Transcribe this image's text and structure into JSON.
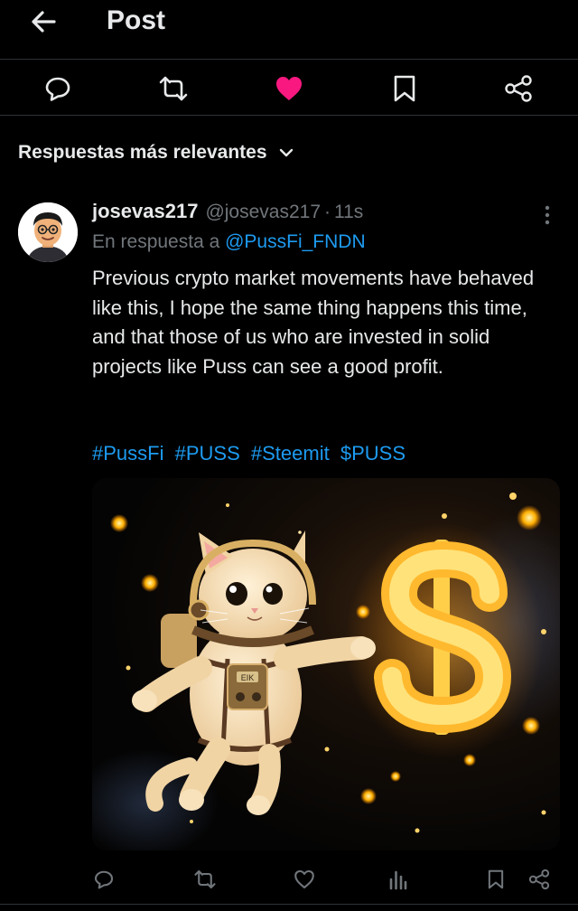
{
  "header": {
    "title": "Post"
  },
  "icons": {
    "back": "arrow-left-icon",
    "reply": "reply-icon",
    "repost": "repost-icon",
    "like": "heart-filled-icon",
    "bookmark": "bookmark-icon",
    "share": "share-icon",
    "more": "more-vertical-icon",
    "views": "views-icon"
  },
  "colors": {
    "background": "#000000",
    "text": "#e7e9ea",
    "muted": "#71767b",
    "link": "#1d9bf0",
    "like": "#f91880",
    "divider": "#2f3336"
  },
  "sort": {
    "label": "Respuestas más relevantes"
  },
  "reply": {
    "display_name": "josevas217",
    "handle": "@josevas217",
    "separator": "·",
    "time": "11s",
    "in_reply_prefix": "En respuesta a",
    "in_reply_to": "@PussFi_FNDN",
    "text": "Previous crypto market movements have behaved like this, I hope the same thing happens this time, and that those of us who are invested in solid projects like Puss can see a good profit.",
    "hashtags": [
      "#PussFi",
      "#PUSS",
      "#Steemit",
      "$PUSS"
    ],
    "media_badge": "EIK"
  }
}
